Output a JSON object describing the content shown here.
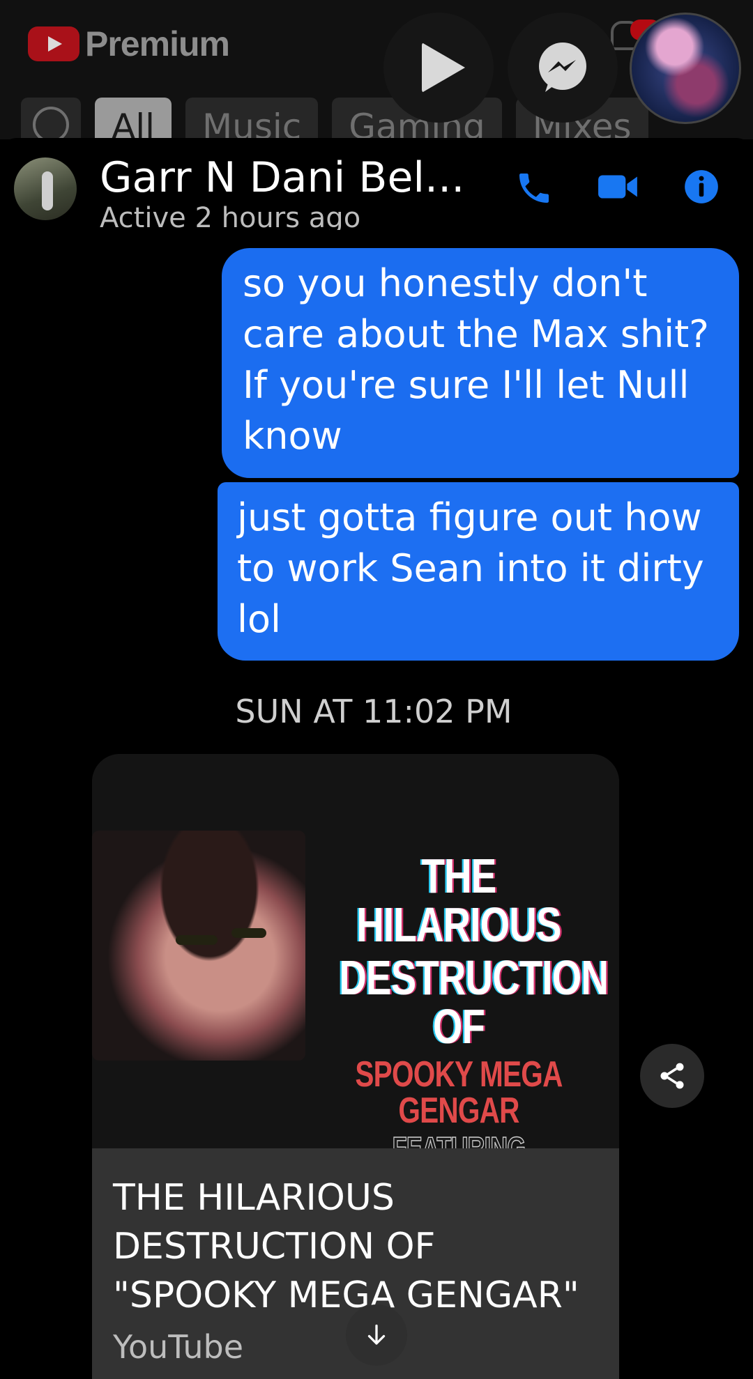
{
  "youtube": {
    "brand": "Premium",
    "chips": [
      "All",
      "Music",
      "Gaming",
      "Mixes"
    ]
  },
  "chat_header": {
    "name": "Garr N Dani Bel...",
    "status": "Active 2 hours ago"
  },
  "messages": [
    {
      "text": "so you honestly don't care about the Max shit? If you're sure I'll let Null know",
      "direction": "outgoing"
    },
    {
      "text": "just gotta figure out how to work Sean into it dirty lol",
      "direction": "outgoing"
    }
  ],
  "timestamp": "SUN AT 11:02 PM",
  "link_card": {
    "thumbnail_lines": [
      "THE HILARIOUS",
      "DESTRUCTION OF",
      "SPOOKY MEGA GENGAR",
      "FEATURING TRYPTAMINE"
    ],
    "title": "THE HILARIOUS DESTRUCTION OF \"SPOOKY MEGA GENGAR\"",
    "source": "YouTube"
  },
  "colors": {
    "outgoing_bubble": "#1b6df0",
    "icon_blue": "#1877f2",
    "youtube_red": "#c4121b"
  }
}
